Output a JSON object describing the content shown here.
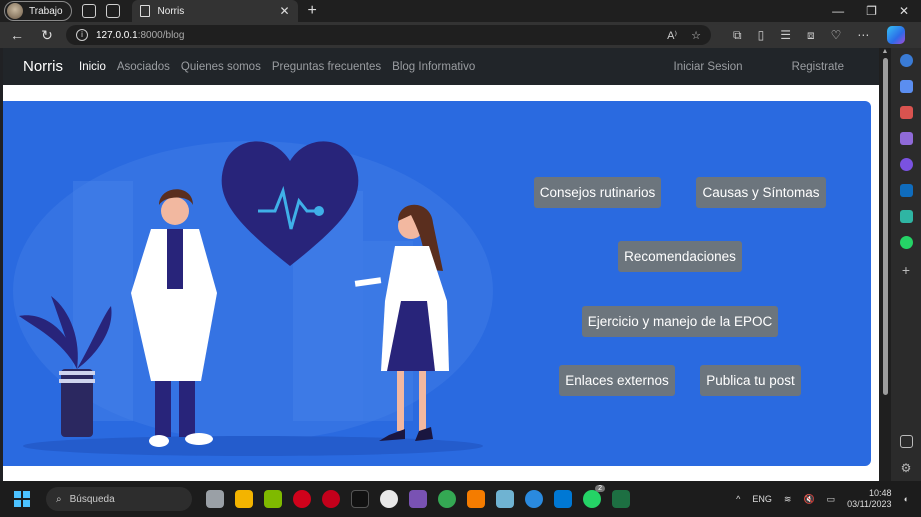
{
  "browser": {
    "profile_label": "Trabajo",
    "tab_title": "Norris",
    "tab_close": "✕",
    "new_tab": "+",
    "url_host": "127.0.0.1",
    "url_path": ":8000/blog",
    "window_controls": [
      "—",
      "❐",
      "✕"
    ]
  },
  "navbar": {
    "brand": "Norris",
    "links": [
      "Inicio",
      "Asociados",
      "Quienes somos",
      "Preguntas frecuentes",
      "Blog Informativo"
    ],
    "active_index": 0,
    "right_links": [
      "Iniciar Sesion",
      "Registrate"
    ]
  },
  "hero": {
    "buttons": [
      "Consejos rutinarios",
      "Causas y Síntomas",
      "Recomendaciones",
      "Ejercicio y manejo de la EPOC",
      "Enlaces externos",
      "Publica tu post"
    ]
  },
  "taskbar": {
    "search_placeholder": "Búsqueda",
    "language": "ENG",
    "time": "10:48",
    "date": "03/11/2023",
    "whatsapp_badge": "2"
  },
  "colors": {
    "hero_blue": "#2a6ae0",
    "navbar_dark": "#212529",
    "button_gray": "#6c757d",
    "heart_navy": "#28247a"
  }
}
